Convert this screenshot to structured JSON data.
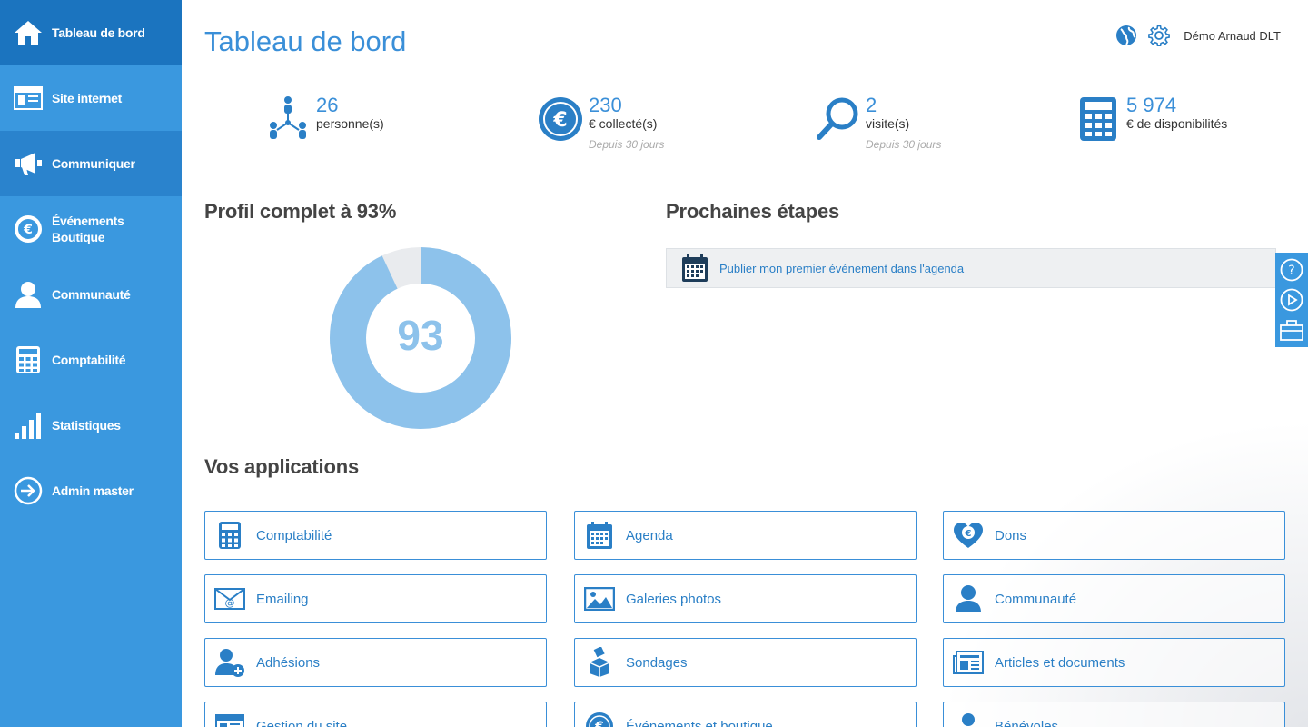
{
  "sidebar": {
    "items": [
      {
        "label": "Tableau de bord",
        "icon": "home-icon"
      },
      {
        "label": "Site internet",
        "icon": "website-icon"
      },
      {
        "label": "Communiquer",
        "icon": "megaphone-icon"
      },
      {
        "label1": "Événements",
        "label2": "Boutique",
        "icon": "euro-icon"
      },
      {
        "label": "Communauté",
        "icon": "user-icon"
      },
      {
        "label": "Comptabilité",
        "icon": "calculator-icon"
      },
      {
        "label": "Statistiques",
        "icon": "bar-chart-icon"
      },
      {
        "label": "Admin master",
        "icon": "arrow-circle-icon"
      }
    ]
  },
  "header": {
    "title": "Tableau de bord",
    "user": "Démo Arnaud DLT"
  },
  "stats": [
    {
      "value": "26",
      "label": "personne(s)",
      "sub": ""
    },
    {
      "value": "230",
      "label": "€ collecté(s)",
      "sub": "Depuis 30 jours"
    },
    {
      "value": "2",
      "label": "visite(s)",
      "sub": "Depuis 30 jours"
    },
    {
      "value": "5 974",
      "label": "€ de disponibilités",
      "sub": ""
    }
  ],
  "profile": {
    "title": "Profil complet à 93%",
    "percent": 93,
    "display": "93",
    "fill_color": "#8dc2eb",
    "rest_color": "#e9ebee"
  },
  "next_steps": {
    "title": "Prochaines étapes",
    "items": [
      "Publier mon premier événement dans l'agenda"
    ]
  },
  "apps": {
    "title": "Vos applications",
    "items": [
      {
        "label": "Comptabilité",
        "icon": "calculator-icon"
      },
      {
        "label": "Agenda",
        "icon": "calendar-icon"
      },
      {
        "label": "Dons",
        "icon": "heart-euro-icon"
      },
      {
        "label": "Emailing",
        "icon": "envelope-icon"
      },
      {
        "label": "Galeries photos",
        "icon": "photo-icon"
      },
      {
        "label": "Communauté",
        "icon": "user-icon"
      },
      {
        "label": "Adhésions",
        "icon": "add-user-icon"
      },
      {
        "label": "Sondages",
        "icon": "ballot-box-icon"
      },
      {
        "label": "Articles et documents",
        "icon": "newspaper-icon"
      },
      {
        "label": "Gestion du site",
        "icon": "website-icon"
      },
      {
        "label": "Événements et boutique",
        "icon": "euro-icon"
      },
      {
        "label": "Bénévoles",
        "icon": "volunteer-icon"
      }
    ]
  },
  "colors": {
    "sidebar": "#3a98df",
    "sidebar_active": "#1b74bf",
    "accent": "#3a8fd8"
  }
}
